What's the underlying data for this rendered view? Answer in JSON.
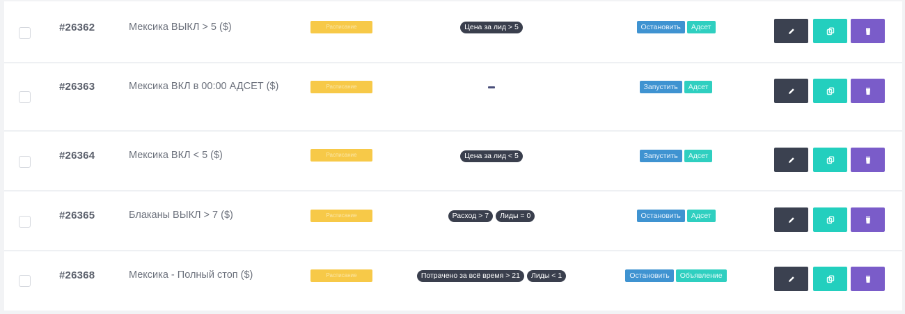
{
  "rows": [
    {
      "id": "#26362",
      "name": "Мексика ВЫКЛ > 5 ($)",
      "status": "Расписание",
      "conditions": [
        "Цена за лид > 5"
      ],
      "action": "Остановить",
      "level": "Адсет"
    },
    {
      "id": "#26363",
      "name": "Мексика ВКЛ в 00:00 АДСЕТ ($)",
      "status": "Расписание",
      "conditions": [
        "–"
      ],
      "action": "Запустить",
      "level": "Адсет"
    },
    {
      "id": "#26364",
      "name": "Мексика ВКЛ < 5 ($)",
      "status": "Расписание",
      "conditions": [
        "Цена за лид < 5"
      ],
      "action": "Запустить",
      "level": "Адсет"
    },
    {
      "id": "#26365",
      "name": "Блаканы ВЫКЛ > 7 ($)",
      "status": "Расписание",
      "conditions": [
        "Расход > 7",
        "Лиды = 0"
      ],
      "action": "Остановить",
      "level": "Адсет"
    },
    {
      "id": "#26368",
      "name": "Мексика - Полный стоп ($)",
      "status": "Расписание",
      "conditions": [
        "Потрачено за всё время > 21",
        "Лиды < 1"
      ],
      "action": "Остановить",
      "level": "Объявление"
    }
  ],
  "icons": {
    "edit": "pencil-icon",
    "copy": "copy-icon",
    "delete": "trash-icon"
  },
  "colors": {
    "status_badge": "#f7c948",
    "condition_pill": "#3a3f4d",
    "action_button": "#3f93d1",
    "level_tag": "#2fcfc0",
    "edit_button": "#3b4150",
    "copy_button": "#23cfbe",
    "delete_button": "#7a5cc9"
  }
}
